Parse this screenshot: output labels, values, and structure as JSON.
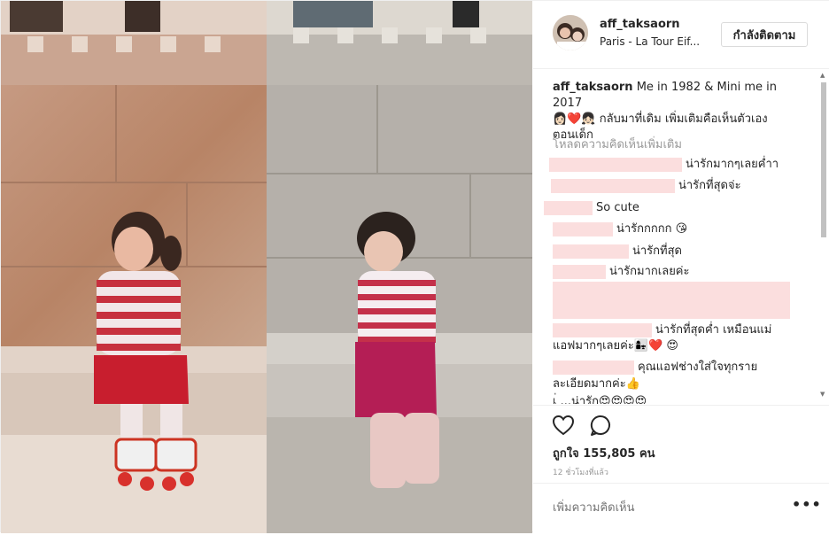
{
  "header": {
    "username": "aff_taksaorn",
    "location": "Paris - La Tour Eif...",
    "follow_label": "กำลังติดตาม"
  },
  "caption": {
    "username": "aff_taksaorn",
    "text_line1": "Me in 1982 & Mini me in 2017",
    "emoji_line": "👩🏻❤️👧🏻",
    "text_line2": "กลับมาที่เดิม เพิ่มเติมคือเห็นตัวเอง",
    "text_line3": "ตอนเด็ก"
  },
  "load_more_label": "โหลดความคิดเห็นเพิ่มเติม",
  "comments": [
    {
      "text": "น่ารักมากๆเลยค่ำา"
    },
    {
      "text": "น่ารักที่สุดจ่ะ"
    },
    {
      "text": "So cute"
    },
    {
      "text": "น่ารักกกกก",
      "emoji": "😘"
    },
    {
      "text": "น่ารักที่สุด"
    },
    {
      "text": "น่ารักมากเลยค่ะ"
    },
    {
      "text": "น่ารักที่สุดค่ำ เหมือนแม่"
    },
    {
      "text": "แอฟมากๆเลยค่ะ",
      "emoji": "👩‍👧❤️ 😍"
    },
    {
      "text": "คุณแอฟช่างใส่ใจทุกราย"
    },
    {
      "text": "ละเอียดมากค่ะ",
      "emoji": "👍"
    },
    {
      "text": "เ่ ...น่ารัก",
      "emoji": "😍😍😍😍"
    }
  ],
  "actions": {
    "like_icon": "heart-icon",
    "comment_icon": "comment-bubble-icon",
    "likes_text": "ถูกใจ 155,805 คน",
    "timestamp": "12 ชั่วโมงที่แล้ว"
  },
  "comment_box": {
    "placeholder": "เพิ่มความคิดเห็น",
    "more_label": "•••"
  },
  "colors": {
    "redaction": "#fbdede",
    "border": "#efefef",
    "muted_text": "#999999"
  }
}
